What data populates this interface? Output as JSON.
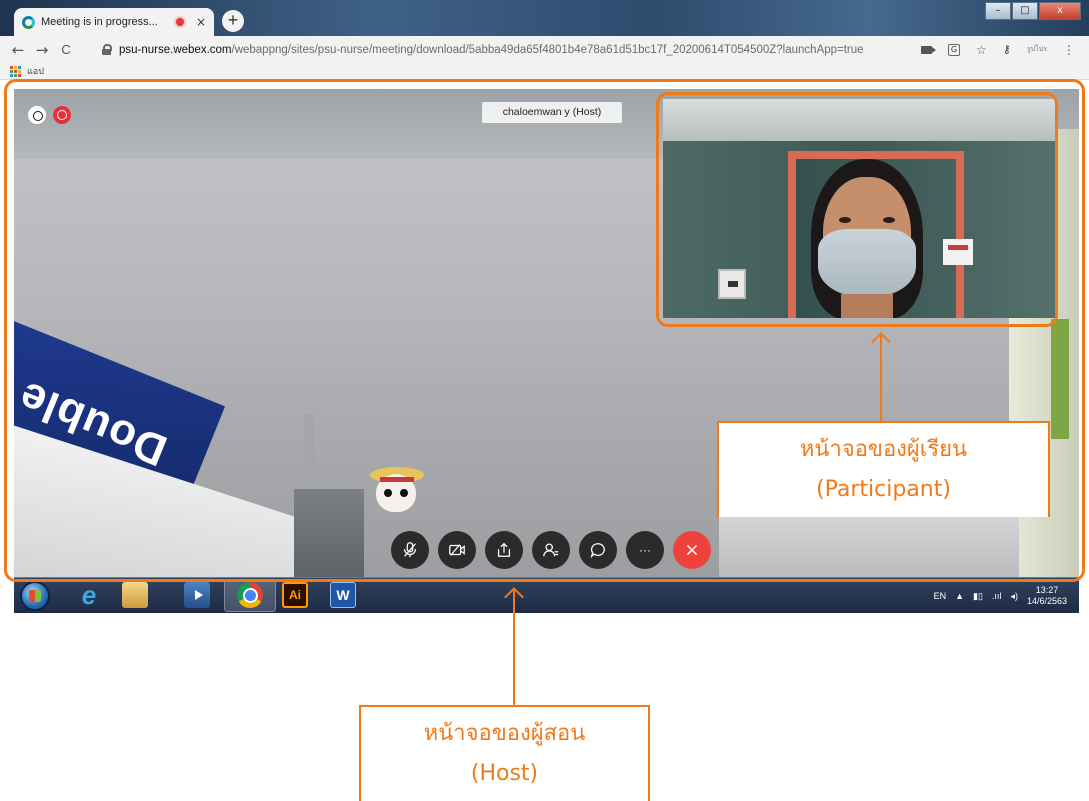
{
  "browser": {
    "tab_title": "Meeting is in progress...",
    "tab_close": "×",
    "new_tab": "+",
    "nav_back": "←",
    "nav_forward": "→",
    "nav_reload": "C",
    "url_host": "psu-nurse.webex.com",
    "url_path": "/webappng/sites/psu-nurse/meeting/download/5abba49da65f4801b4e78a61d51bc17f_20200614T054500Z?launchApp=true",
    "bookmark_apps": "แอป",
    "profile_label": "รูปโปร",
    "window_controls": {
      "minimize": "–",
      "maximize": "□",
      "close": "x"
    }
  },
  "meeting": {
    "host_name_label": "chaloemwan y (Host)",
    "background_text": "Double H",
    "controls": [
      "mute",
      "stop-video",
      "share",
      "participants",
      "chat",
      "more",
      "end-meeting"
    ],
    "more_label": "···"
  },
  "taskbar": {
    "language": "EN",
    "time": "13:27",
    "date": "14/6/2563",
    "illustrator_label": "Ai",
    "word_label": "W"
  },
  "annotations": {
    "participant_line1": "หน้าจอของผู้เรียน",
    "participant_line2": "(Participant)",
    "host_line1": "หน้าจอของผู้สอน",
    "host_line2": "(Host)"
  },
  "colors": {
    "annotation_orange": "#f07a1a",
    "end_call_red": "#f0423d",
    "recording_red": "#e8303a"
  }
}
